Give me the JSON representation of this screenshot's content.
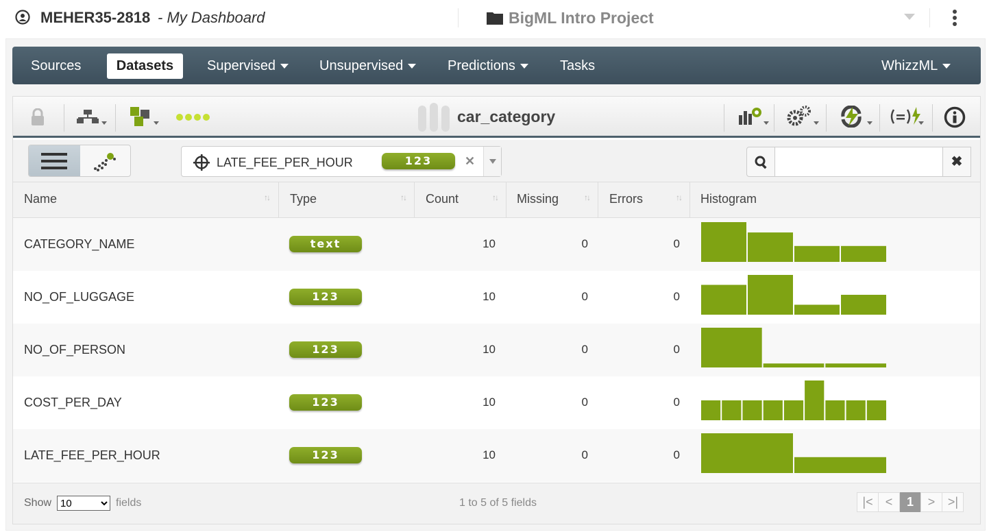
{
  "header": {
    "user": "MEHER35-2818",
    "separator": "- My Dashboard",
    "project": "BigML Intro Project"
  },
  "nav": {
    "items": [
      {
        "label": "Sources"
      },
      {
        "label": "Datasets"
      },
      {
        "label": "Supervised"
      },
      {
        "label": "Unsupervised"
      },
      {
        "label": "Predictions"
      },
      {
        "label": "Tasks"
      },
      {
        "label": "WhizzML"
      }
    ]
  },
  "dataset": {
    "title": "car_category"
  },
  "objective": {
    "field": "LATE_FEE_PER_HOUR",
    "type": "123"
  },
  "search": {
    "placeholder": ""
  },
  "table": {
    "columns": [
      "Name",
      "Type",
      "Count",
      "Missing",
      "Errors",
      "Histogram"
    ],
    "rows": [
      {
        "name": "CATEGORY_NAME",
        "type": "text",
        "count": "10",
        "missing": "0",
        "errors": "0",
        "hist": [
          1.0,
          0.74,
          0.4,
          0.4
        ]
      },
      {
        "name": "NO_OF_LUGGAGE",
        "type": "123",
        "count": "10",
        "missing": "0",
        "errors": "0",
        "hist": [
          0.75,
          1.0,
          0.25,
          0.5
        ]
      },
      {
        "name": "NO_OF_PERSON",
        "type": "123",
        "count": "10",
        "missing": "0",
        "errors": "0",
        "hist": [
          1.0,
          0.1,
          0.1
        ]
      },
      {
        "name": "COST_PER_DAY",
        "type": "123",
        "count": "10",
        "missing": "0",
        "errors": "0",
        "hist": [
          0.5,
          0.5,
          0.5,
          0.5,
          0.5,
          1.0,
          0.5,
          0.5,
          0.5
        ]
      },
      {
        "name": "LATE_FEE_PER_HOUR",
        "type": "123",
        "count": "10",
        "missing": "0",
        "errors": "0",
        "hist": [
          1.0,
          0.4
        ]
      }
    ]
  },
  "footer": {
    "show_label": "Show",
    "show_value": "10",
    "fields_label": "fields",
    "range": "1 to 5 of 5 fields",
    "page": "1"
  },
  "colors": {
    "accent_green": "#7fa313",
    "nav_bg": "#45596a"
  }
}
